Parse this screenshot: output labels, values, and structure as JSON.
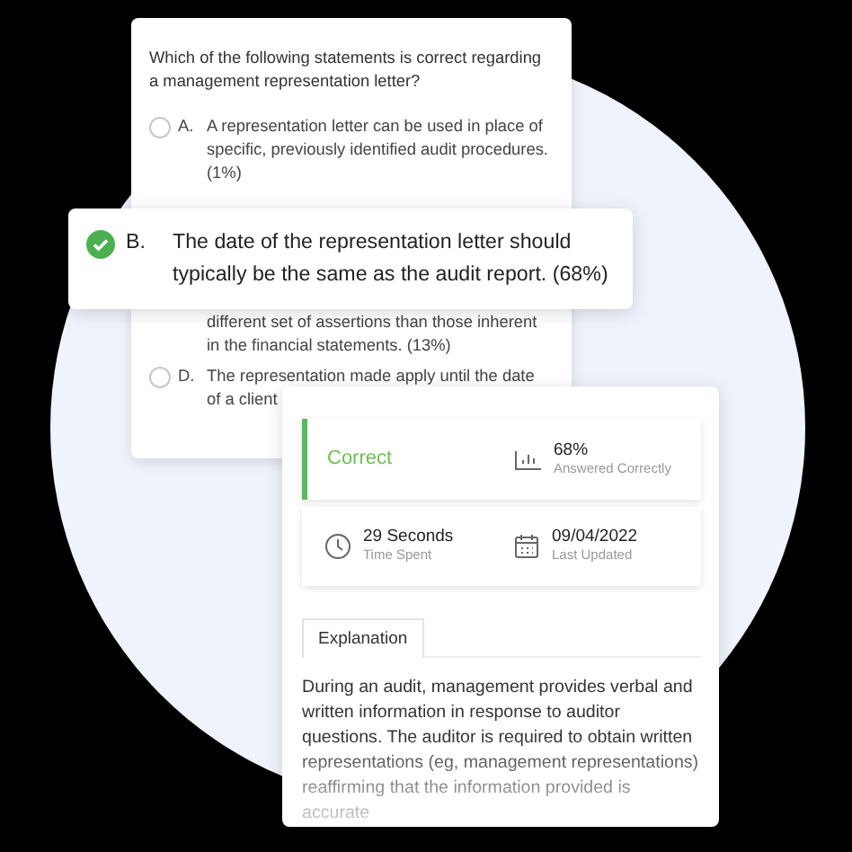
{
  "question": {
    "text": "Which of the following statements is correct regarding a management representation letter?",
    "options": [
      {
        "letter": "A.",
        "text": "A representation letter can be used in place of specific, previously identified audit procedures. (1%)",
        "selected": false
      },
      {
        "letter": "B.",
        "text": "The date of the representation letter should typically be the same as the audit report. (68%)",
        "selected": true
      },
      {
        "text": "different set of assertions than those inherent in the financial statements. (13%)",
        "selected": false
      },
      {
        "letter": "D.",
        "text": "The representation made apply until the date of a client",
        "selected": false
      }
    ]
  },
  "result": {
    "status": "Correct",
    "stats": [
      {
        "kind": "chart",
        "value": "68%",
        "label": "Answered Correctly"
      },
      {
        "kind": "clock",
        "value": "29 Seconds",
        "label": "Time Spent"
      },
      {
        "kind": "calendar",
        "value": "09/04/2022",
        "label": "Last Updated"
      }
    ],
    "tabs": [
      {
        "label": "Explanation",
        "selected": true
      }
    ],
    "explanation": "During an audit, management provides verbal and written information in response to auditor questions. The auditor is required to obtain written representations (eg, management representations) reaffirming that the information provided is accurate"
  }
}
